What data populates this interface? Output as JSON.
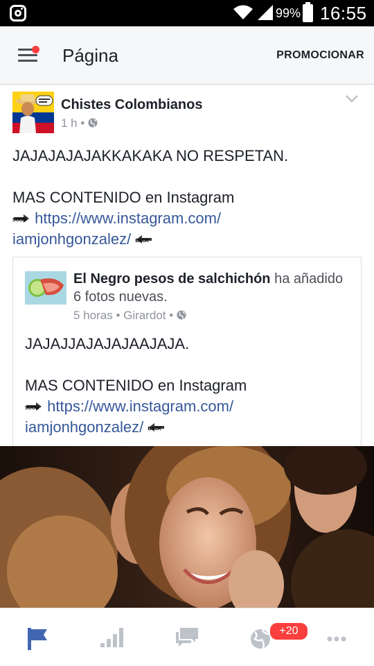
{
  "status_bar": {
    "battery_percent": "99%",
    "time": "16:55",
    "icons": [
      "instagram-icon",
      "wifi-icon",
      "signal-icon",
      "battery-icon"
    ]
  },
  "app_bar": {
    "title": "Página",
    "promote_label": "PROMOCIONAR",
    "has_notification_dot": true
  },
  "post": {
    "author": "Chistes Colombianos",
    "time": "1 h",
    "line1": "JAJAJAJAJAKKAKAKA NO RESPETAN.",
    "line2": "MAS CONTENIDO en Instagram",
    "link_part1": "https://www.instagram.com/",
    "link_part2": "iamjonhgonzalez/",
    "soon_label": "SOON",
    "back_label": "BACK",
    "shared": {
      "author": "El Negro pesos de salchichón",
      "action": " ha añadido 6 fotos nuevas.",
      "time": "5 horas",
      "location": "Girardot",
      "line1": "JAJAJJAJAJAJAAJAJA.",
      "line2": "MAS CONTENIDO en Instagram",
      "link_part1": "https://www.instagram.com/",
      "link_part2": "iamjonhgonzalez/",
      "soon_label": "SOON",
      "back_label": "BACK"
    }
  },
  "bottom_nav": {
    "items": [
      "page-flag-icon",
      "insights-icon",
      "messages-icon",
      "notifications-globe-icon",
      "more-icon"
    ],
    "notifications_badge": "+20",
    "active_color": "#4267b2",
    "inactive_color": "#bec2c9"
  }
}
